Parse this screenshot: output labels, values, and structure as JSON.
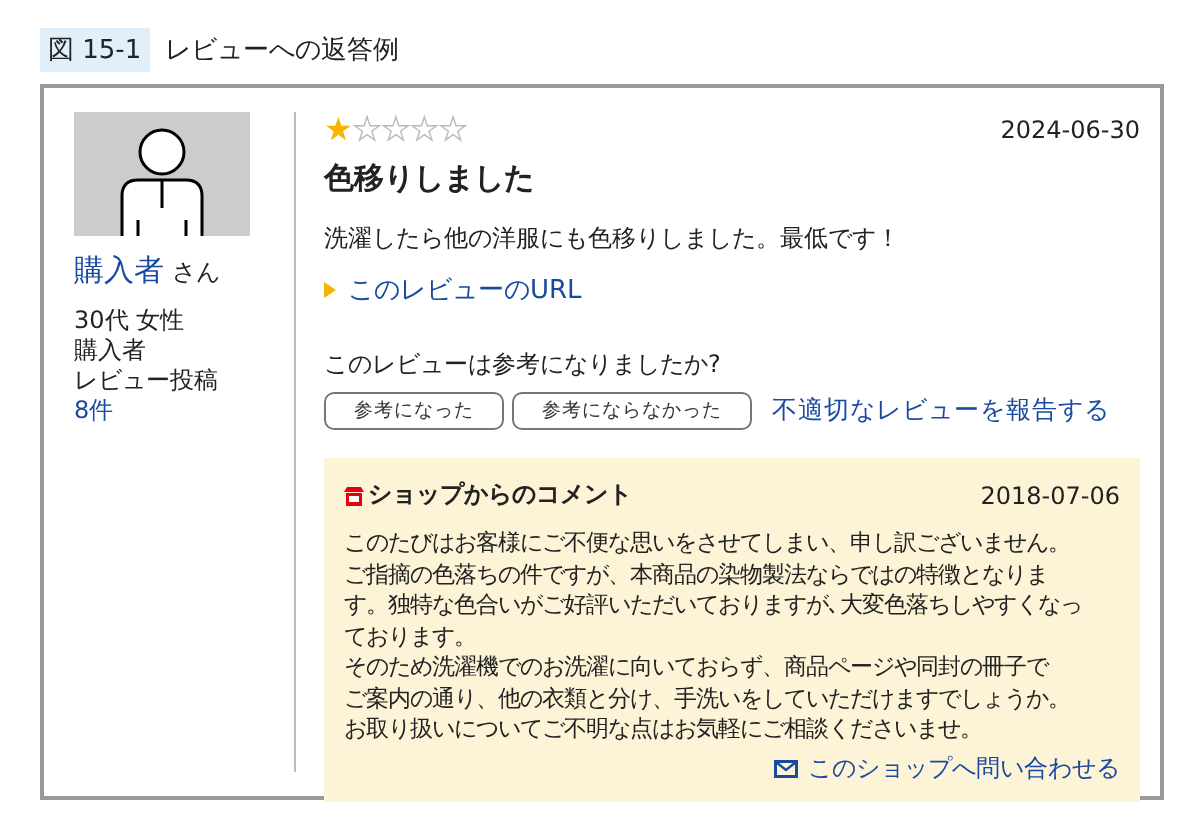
{
  "caption": {
    "label": "図 15-1",
    "title": "レビューへの返答例"
  },
  "reviewer": {
    "name": "購入者",
    "honorific": "さん",
    "details": [
      "30代 女性",
      "購入者",
      "レビュー投稿"
    ],
    "review_count": "8件"
  },
  "review": {
    "stars": 1,
    "date": "2024-06-30",
    "title": "色移りしました",
    "body": "洗濯したら他の洋服にも色移りしました。最低です！",
    "url_link": "このレビューのURL",
    "helpful_question": "このレビューは参考になりましたか?",
    "buttons": [
      "参考になった",
      "参考にならなかった"
    ],
    "report_link": "不適切なレビューを報告する"
  },
  "shop_comment": {
    "title": "ショップからのコメント",
    "date": "2018-07-06",
    "lines": [
      "このたびはお客様にご不便な思いをさせてしまい、申し訳ございません。",
      "ご指摘の色落ちの件ですが、本商品の染物製法ならではの特徴となりま",
      "す。独特な色合いがご好評いただいておりますが､大変色落ちしやすくなっ",
      "ております。",
      "そのため洗濯機でのお洗濯に向いておらず、商品ページや同封の冊子で",
      "ご案内の通り、他の衣類と分け、手洗いをしていただけますでしょうか。",
      "お取り扱いについてご不明な点はお気軽にご相談くださいませ。"
    ],
    "contact_link": "このショップへ問い合わせる"
  }
}
